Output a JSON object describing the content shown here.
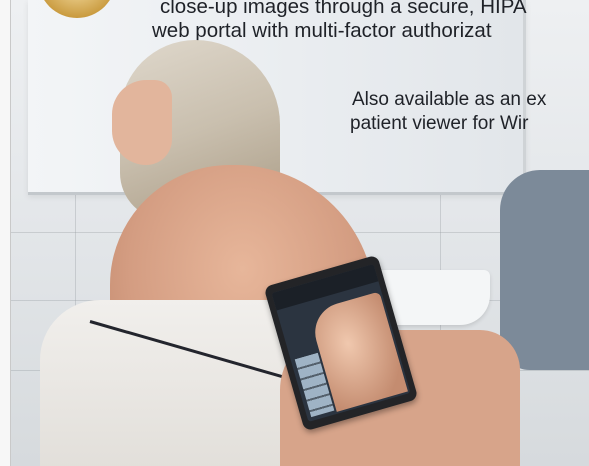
{
  "headline": {
    "line1": "close-up images through a secure, HIPA",
    "line2": "web portal with multi-factor authorizat"
  },
  "subheadline": {
    "line1": "Also available as an ex",
    "line2": "patient viewer for Wir"
  },
  "photo": {
    "scene": "man-holding-tablet-imaging-woman-back",
    "accent_color": "#c99a3e"
  }
}
